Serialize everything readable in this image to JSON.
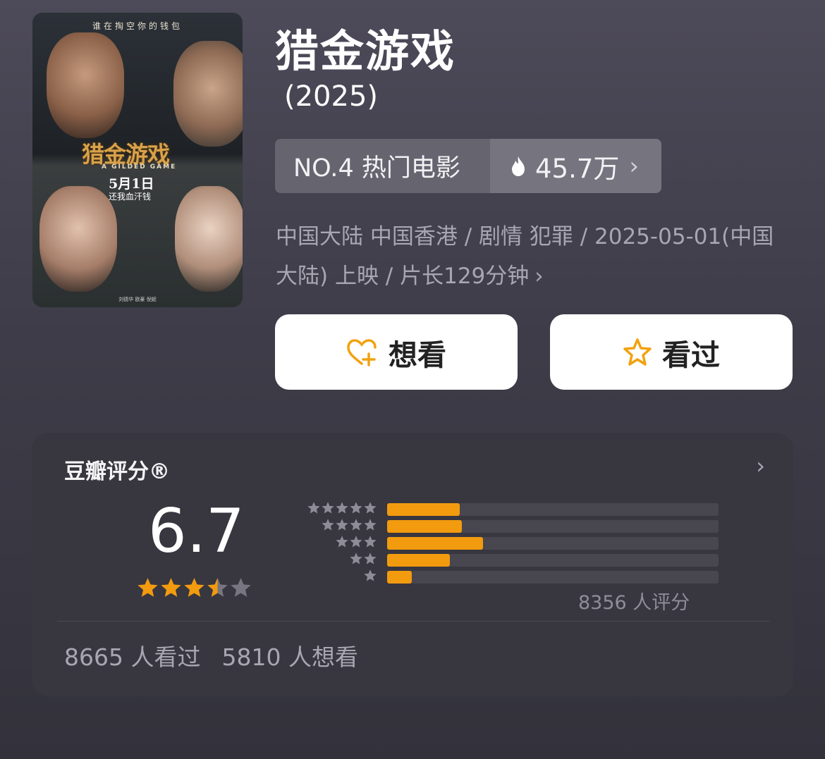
{
  "movie": {
    "title": "猎金游戏",
    "year": "(2025)",
    "poster": {
      "tagline": "谁在掏空你的钱包",
      "title": "猎金游戏",
      "subtitle": "A GILDED GAME",
      "date": "5月1日",
      "slogan": "还我血汗钱",
      "credits": "刘德华 欧豪 倪妮"
    }
  },
  "rank": {
    "label": "NO.4 热门电影",
    "heat": "45.7万"
  },
  "meta": {
    "info": "中国大陆 中国香港 / 剧情 犯罪 / 2025-05-01(中国大陆) 上映 / 片长129分钟"
  },
  "actions": {
    "want_label": "想看",
    "seen_label": "看过"
  },
  "rating": {
    "title": "豆瓣评分®",
    "score": "6.7",
    "star_value": 3.5,
    "votes": "8356 人评分",
    "distribution": [
      {
        "stars": 5,
        "fraction": 0.22
      },
      {
        "stars": 4,
        "fraction": 0.225
      },
      {
        "stars": 3,
        "fraction": 0.29
      },
      {
        "stars": 2,
        "fraction": 0.19
      },
      {
        "stars": 1,
        "fraction": 0.075
      }
    ],
    "seen_count": "8665 人看过",
    "want_count": "5810 人想看"
  },
  "colors": {
    "accent": "#f29b0f",
    "background": "#48465a",
    "card": "#38363f"
  }
}
